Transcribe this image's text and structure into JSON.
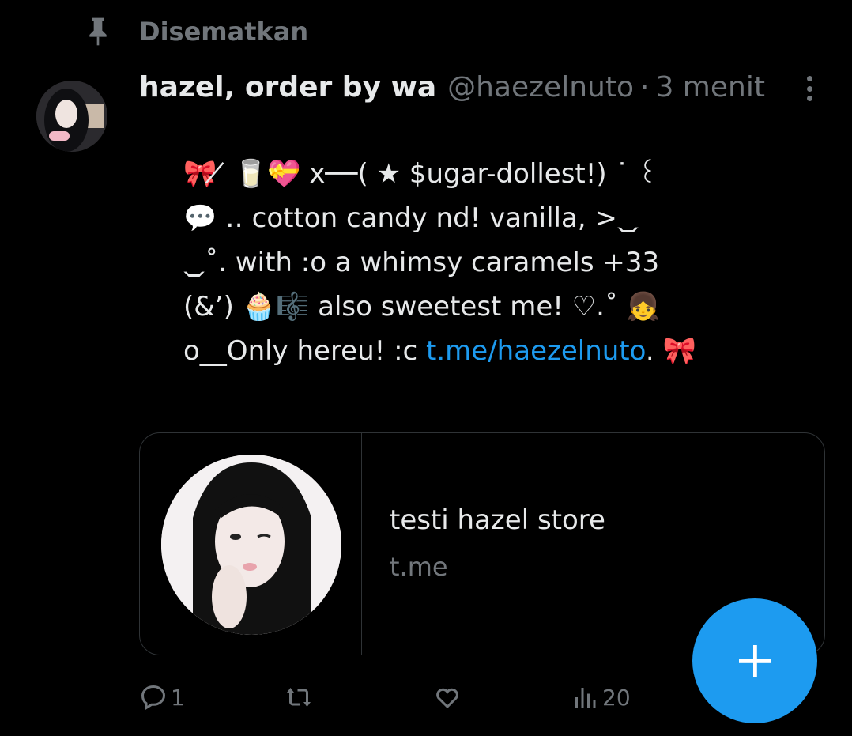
{
  "pinned": {
    "label": "Disematkan",
    "icon": "pin-icon"
  },
  "author": {
    "display_name": "hazel, order by wa",
    "handle": "@haezelnuto",
    "separator": "·",
    "time": "3 menit"
  },
  "tweet": {
    "lines": [
      "🎀 ̸̸ 🥛💝  x──( ★ $ugar-dollest!) ˙ ꒰",
      "💬 ‥  cotton candy nd! vanilla, >⏡",
      "⏡˚. with :o a whimsy caramels +33",
      "(&’) 🧁🎼   also sweetest me!  ♡.˚ 👧",
      "o__Only hereu! :c "
    ],
    "link_text": "t.me/haezelnuto",
    "after_link": ". 🎀"
  },
  "card": {
    "title": "testi hazel store",
    "domain": "t.me"
  },
  "actions": {
    "reply_count": "1",
    "views_count": "20"
  },
  "colors": {
    "accent": "#1d9bf0",
    "muted": "#71767b",
    "background": "#000000"
  }
}
